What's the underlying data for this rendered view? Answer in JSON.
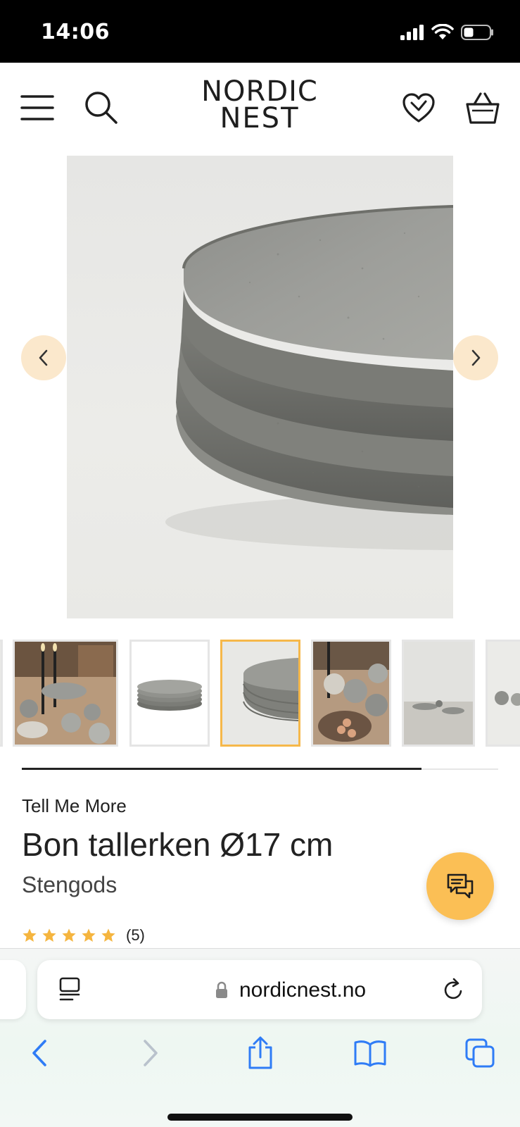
{
  "status_bar": {
    "time": "14:06"
  },
  "header": {
    "logo_line1": "NORDIC",
    "logo_line2": "NEST",
    "icons": [
      "menu-icon",
      "search-icon",
      "heart-icon",
      "basket-icon"
    ]
  },
  "gallery": {
    "image_count_visible": 7,
    "active_thumbnail": 3,
    "thumbnails": [
      "table-setting-with-candles",
      "stacked-plates-side",
      "stacked-plates-closeup",
      "table-setting-with-cups",
      "linen-table-setting",
      "cups-partial",
      "partial-image"
    ]
  },
  "product": {
    "brand": "Tell Me More",
    "title": "Bon tallerken Ø17 cm",
    "subtitle": "Stengods",
    "rating_stars": 5,
    "rating_count": "(5)"
  },
  "browser": {
    "url": "nordicnest.no"
  },
  "colors": {
    "accent_orange": "#fbbf55",
    "carousel_button_bg": "#fbe8cc",
    "active_thumb_border": "#f6b84a",
    "star": "#f5b53f",
    "ios_blue": "#2f7cf6"
  }
}
